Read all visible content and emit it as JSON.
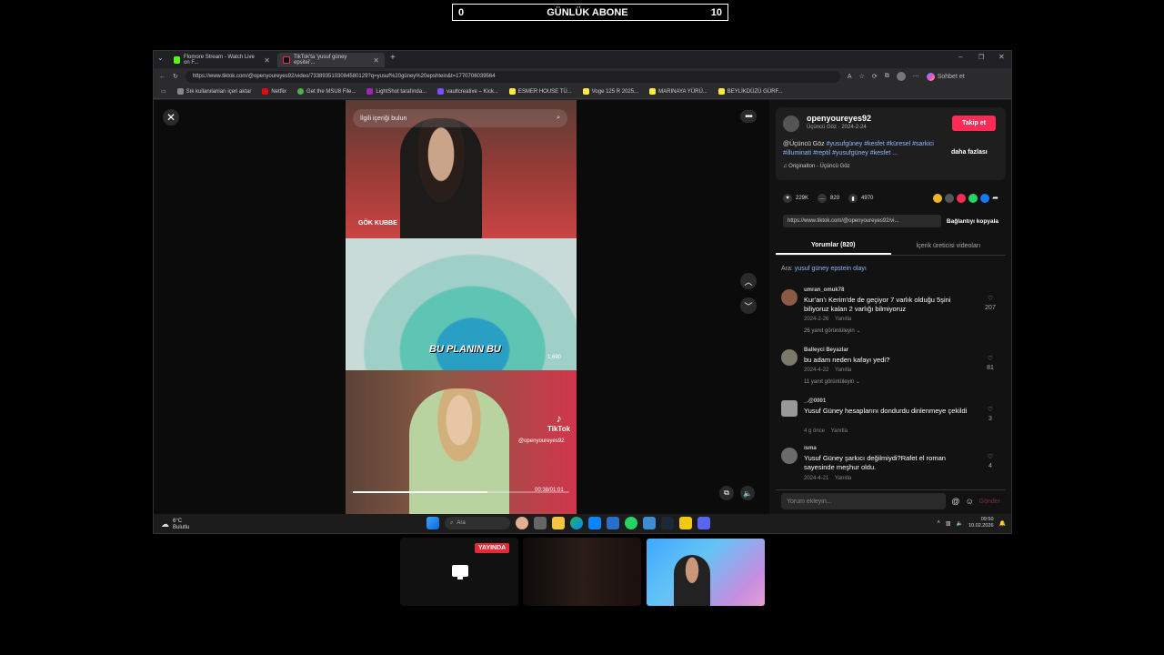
{
  "banner": {
    "left": "0",
    "title": "GÜNLÜK ABONE",
    "right": "10"
  },
  "browser": {
    "tabs": [
      {
        "label": "Flomore Stream - Watch Live on F..."
      },
      {
        "label": "TikTok'ta 'yusuf güney epsitei'..."
      }
    ],
    "url": "https://www.tiktok.com/@openyoureyes92/video/7338935103084580129?q=yusuf%20güney%20epshtein&t=1770706039564",
    "profile_label": "Sohbet et",
    "bookmarks": [
      {
        "label": "Sık kullanılanları içeri aktar",
        "color": "#888888"
      },
      {
        "label": "Netflix",
        "color": "#e50914"
      },
      {
        "label": "Get the MSU8 File...",
        "color": "#4caf50"
      },
      {
        "label": "LightShot tarafında...",
        "color": "#9c27b0"
      },
      {
        "label": "vaultcreative – Kick...",
        "color": "#7c4dff"
      },
      {
        "label": "ESMER HOUSE TÜ...",
        "color": "#ffeb3b"
      },
      {
        "label": "Voge 125 R 2025...",
        "color": "#ffeb3b"
      },
      {
        "label": "MARINAYA YÜRÜ...",
        "color": "#ffeb3b"
      },
      {
        "label": "BEYLİKDÜZÜ GÜRF...",
        "color": "#ffeb3b"
      }
    ]
  },
  "video": {
    "search_placeholder": "İlgili içeriği bulun",
    "label_top": "GÖK KUBBE",
    "caption": "BU PLANIN BU",
    "small_count": "1,690",
    "watermark": "TikTok",
    "handle": "@openyoureyes92",
    "time": "00:38/01:01",
    "progress": 0.62
  },
  "side": {
    "author": "openyoureyes92",
    "author_sub": "Üçüncü Göz · 2024-2-24",
    "follow_label": "Takip et",
    "desc_prefix": "@Üçüncü Göz ",
    "desc_tags": "#yusufgüney #kesfet #küresel #sarkici #illuminati #reptil #yusufgüney #kesfet ...",
    "more_label": "daha fazlası",
    "sound": "♫  Originalton - Üçüncü Göz",
    "likes": "229K",
    "comments": "820",
    "saves": "4970",
    "link": "https://www.tiktok.com/@openyoureyes92/vi...",
    "copy_label": "Bağlantıyı kopyala",
    "tab_comments": "Yorumlar (820)",
    "tab_creator": "İçerik üreticisi videoları",
    "suggest_prefix": "Ara: ",
    "suggest_query": "yusuf güney epstein olayı",
    "comments_list": [
      {
        "user": "umran_omuk78",
        "text": "Kur'an'ı Kerim'de de geçiyor 7 varlık olduğu 5şini biliyoruz kalan 2 varlığı bilmiyoruz",
        "date": "2024-2-26",
        "reply": "Yanıtla",
        "replies": "26 yanıt görüntüleyin ⌄",
        "likes": "207"
      },
      {
        "user": "Balleyci Beyazlar",
        "text": "bu adam neden kafayı yedi?",
        "date": "2024-4-22",
        "reply": "Yanıtla",
        "replies": "11 yanıt görüntüleyin ⌄",
        "likes": "81"
      },
      {
        "user": "_.@0001",
        "text": "Yusuf Güney hesaplarını dondurdu dinlenmeye çekildi",
        "date": "4 g önce",
        "reply": "Yanıtla",
        "replies": "",
        "likes": "3"
      },
      {
        "user": "isma",
        "text": "Yusuf Güney şarkıcı değilmiydi?Rafet el roman sayesinde meşhur oldu.",
        "date": "2024-4-21",
        "reply": "Yanıtla",
        "replies": "",
        "likes": "4"
      }
    ],
    "comment_placeholder": "Yorum ekleyin...",
    "post_label": "Gönder"
  },
  "taskbar": {
    "weather_temp": "6°C",
    "weather_desc": "Bulutlu",
    "search_label": "Ara",
    "time": "09:50",
    "date": "10.02.2026"
  },
  "stream": {
    "live_badge": "YAYINDA"
  }
}
